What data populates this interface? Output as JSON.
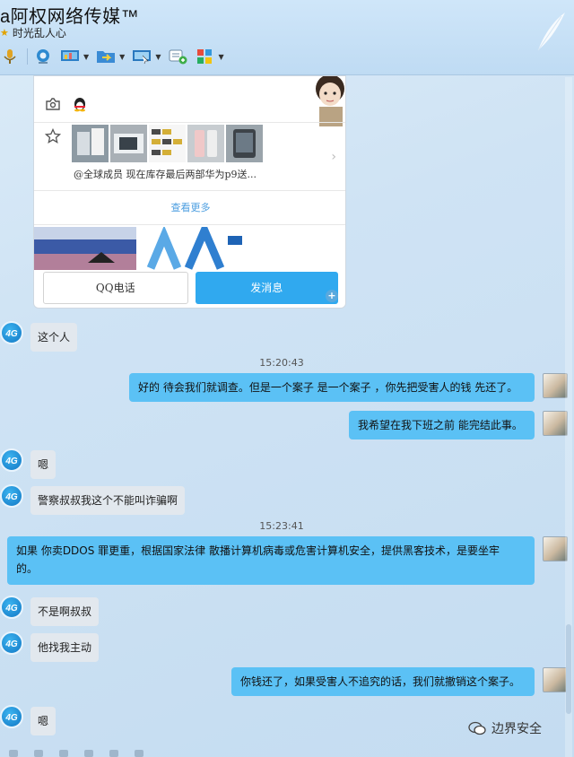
{
  "header": {
    "title": "a阿权网络传媒™",
    "subtitle": "时光乱人心"
  },
  "card": {
    "caption": "@全球成员  现在库存最后两部华为p9送...",
    "more_label": "查看更多",
    "call_button": "QQ电话",
    "send_button": "发消息"
  },
  "messages": [
    {
      "side": "left",
      "text": "这个人"
    },
    {
      "side": "right",
      "text": "好的 待会我们就调查。但是一个案子 是一个案子 ，你先把受害人的钱 先还了。"
    },
    {
      "side": "right",
      "text": "我希望在我下班之前 能完结此事。"
    },
    {
      "side": "left",
      "text": "嗯"
    },
    {
      "side": "left",
      "text": "警察叔叔我这个不能叫诈骗啊"
    },
    {
      "side": "right",
      "text_line1": "如果 你卖DDOS 罪更重，根据国家法律 散播计算机病毒或危害计算机安全，提供黑客技术，是要坐牢",
      "text_line2": "的。"
    },
    {
      "side": "left",
      "text": "不是啊叔叔"
    },
    {
      "side": "left",
      "text": "他找我主动"
    },
    {
      "side": "right",
      "text": "你钱还了，如果受害人不追究的话，我们就撤销这个案子。"
    },
    {
      "side": "left",
      "text": "嗯"
    }
  ],
  "timestamps": [
    "15:20:43",
    "15:23:41"
  ],
  "avatar_left_label": "4G",
  "watermark": "边界安全",
  "colors": {
    "bubble_right": "#5bc1f5",
    "bubble_left": "#e2e8ee",
    "send_button": "#30a9ef"
  }
}
